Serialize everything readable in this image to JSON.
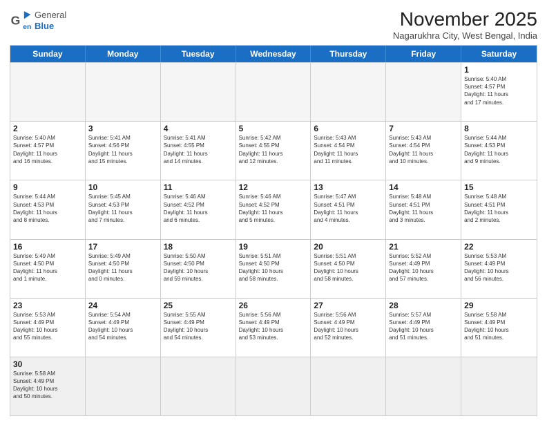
{
  "header": {
    "logo_general": "General",
    "logo_blue": "Blue",
    "month_title": "November 2025",
    "location": "Nagarukhra City, West Bengal, India"
  },
  "days_of_week": [
    "Sunday",
    "Monday",
    "Tuesday",
    "Wednesday",
    "Thursday",
    "Friday",
    "Saturday"
  ],
  "weeks": [
    [
      {
        "day": "",
        "info": ""
      },
      {
        "day": "",
        "info": ""
      },
      {
        "day": "",
        "info": ""
      },
      {
        "day": "",
        "info": ""
      },
      {
        "day": "",
        "info": ""
      },
      {
        "day": "",
        "info": ""
      },
      {
        "day": "1",
        "info": "Sunrise: 5:40 AM\nSunset: 4:57 PM\nDaylight: 11 hours\nand 17 minutes."
      }
    ],
    [
      {
        "day": "2",
        "info": "Sunrise: 5:40 AM\nSunset: 4:57 PM\nDaylight: 11 hours\nand 16 minutes."
      },
      {
        "day": "3",
        "info": "Sunrise: 5:41 AM\nSunset: 4:56 PM\nDaylight: 11 hours\nand 15 minutes."
      },
      {
        "day": "4",
        "info": "Sunrise: 5:41 AM\nSunset: 4:55 PM\nDaylight: 11 hours\nand 14 minutes."
      },
      {
        "day": "5",
        "info": "Sunrise: 5:42 AM\nSunset: 4:55 PM\nDaylight: 11 hours\nand 12 minutes."
      },
      {
        "day": "6",
        "info": "Sunrise: 5:43 AM\nSunset: 4:54 PM\nDaylight: 11 hours\nand 11 minutes."
      },
      {
        "day": "7",
        "info": "Sunrise: 5:43 AM\nSunset: 4:54 PM\nDaylight: 11 hours\nand 10 minutes."
      },
      {
        "day": "8",
        "info": "Sunrise: 5:44 AM\nSunset: 4:53 PM\nDaylight: 11 hours\nand 9 minutes."
      }
    ],
    [
      {
        "day": "9",
        "info": "Sunrise: 5:44 AM\nSunset: 4:53 PM\nDaylight: 11 hours\nand 8 minutes."
      },
      {
        "day": "10",
        "info": "Sunrise: 5:45 AM\nSunset: 4:53 PM\nDaylight: 11 hours\nand 7 minutes."
      },
      {
        "day": "11",
        "info": "Sunrise: 5:46 AM\nSunset: 4:52 PM\nDaylight: 11 hours\nand 6 minutes."
      },
      {
        "day": "12",
        "info": "Sunrise: 5:46 AM\nSunset: 4:52 PM\nDaylight: 11 hours\nand 5 minutes."
      },
      {
        "day": "13",
        "info": "Sunrise: 5:47 AM\nSunset: 4:51 PM\nDaylight: 11 hours\nand 4 minutes."
      },
      {
        "day": "14",
        "info": "Sunrise: 5:48 AM\nSunset: 4:51 PM\nDaylight: 11 hours\nand 3 minutes."
      },
      {
        "day": "15",
        "info": "Sunrise: 5:48 AM\nSunset: 4:51 PM\nDaylight: 11 hours\nand 2 minutes."
      }
    ],
    [
      {
        "day": "16",
        "info": "Sunrise: 5:49 AM\nSunset: 4:50 PM\nDaylight: 11 hours\nand 1 minute."
      },
      {
        "day": "17",
        "info": "Sunrise: 5:49 AM\nSunset: 4:50 PM\nDaylight: 11 hours\nand 0 minutes."
      },
      {
        "day": "18",
        "info": "Sunrise: 5:50 AM\nSunset: 4:50 PM\nDaylight: 10 hours\nand 59 minutes."
      },
      {
        "day": "19",
        "info": "Sunrise: 5:51 AM\nSunset: 4:50 PM\nDaylight: 10 hours\nand 58 minutes."
      },
      {
        "day": "20",
        "info": "Sunrise: 5:51 AM\nSunset: 4:50 PM\nDaylight: 10 hours\nand 58 minutes."
      },
      {
        "day": "21",
        "info": "Sunrise: 5:52 AM\nSunset: 4:49 PM\nDaylight: 10 hours\nand 57 minutes."
      },
      {
        "day": "22",
        "info": "Sunrise: 5:53 AM\nSunset: 4:49 PM\nDaylight: 10 hours\nand 56 minutes."
      }
    ],
    [
      {
        "day": "23",
        "info": "Sunrise: 5:53 AM\nSunset: 4:49 PM\nDaylight: 10 hours\nand 55 minutes."
      },
      {
        "day": "24",
        "info": "Sunrise: 5:54 AM\nSunset: 4:49 PM\nDaylight: 10 hours\nand 54 minutes."
      },
      {
        "day": "25",
        "info": "Sunrise: 5:55 AM\nSunset: 4:49 PM\nDaylight: 10 hours\nand 54 minutes."
      },
      {
        "day": "26",
        "info": "Sunrise: 5:56 AM\nSunset: 4:49 PM\nDaylight: 10 hours\nand 53 minutes."
      },
      {
        "day": "27",
        "info": "Sunrise: 5:56 AM\nSunset: 4:49 PM\nDaylight: 10 hours\nand 52 minutes."
      },
      {
        "day": "28",
        "info": "Sunrise: 5:57 AM\nSunset: 4:49 PM\nDaylight: 10 hours\nand 51 minutes."
      },
      {
        "day": "29",
        "info": "Sunrise: 5:58 AM\nSunset: 4:49 PM\nDaylight: 10 hours\nand 51 minutes."
      }
    ],
    [
      {
        "day": "30",
        "info": "Sunrise: 5:58 AM\nSunset: 4:49 PM\nDaylight: 10 hours\nand 50 minutes."
      },
      {
        "day": "",
        "info": ""
      },
      {
        "day": "",
        "info": ""
      },
      {
        "day": "",
        "info": ""
      },
      {
        "day": "",
        "info": ""
      },
      {
        "day": "",
        "info": ""
      },
      {
        "day": "",
        "info": ""
      }
    ]
  ]
}
